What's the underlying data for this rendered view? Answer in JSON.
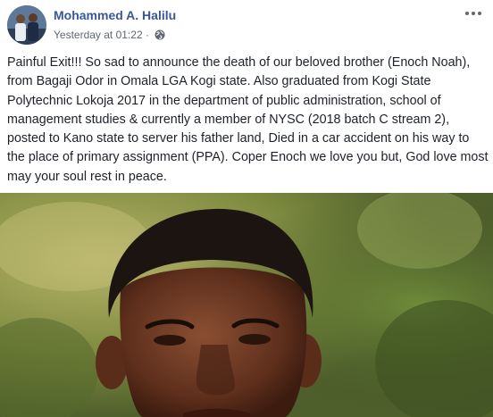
{
  "post": {
    "author": "Mohammed A. Halilu",
    "timestamp": "Yesterday at 01:22",
    "separator": "·",
    "privacy_icon": "globe-icon",
    "more_icon": "more-options-icon",
    "text": "Painful Exit!!! So sad to announce the death of our beloved brother (Enoch Noah), from Bagaji Odor in Omala LGA Kogi state. Also graduated from Kogi State Polytechnic Lokoja 2017 in the department of public administration, school of management studies & currently a member of NYSC (2018 batch C stream 2), posted to Kano state to server his father land, Died in a car accident on his way to the place of primary assignment (PPA). Coper Enoch we love you but, God love most may your soul rest in peace."
  },
  "colors": {
    "author_link": "#385898",
    "meta_text": "#606770",
    "body_text": "#1d2129"
  }
}
